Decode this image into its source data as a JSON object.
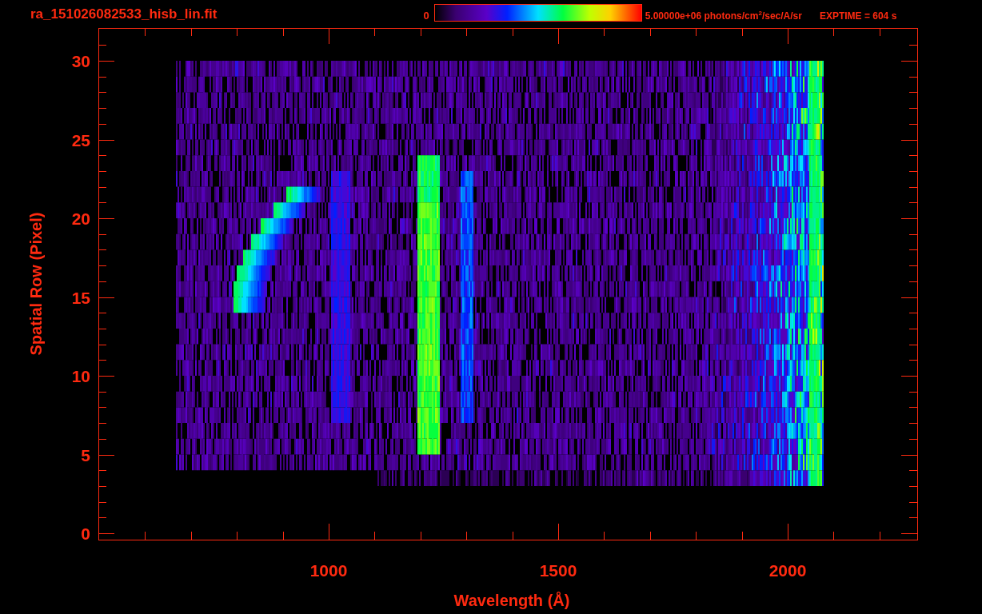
{
  "title": "ra_151026082533_hisb_lin.fit",
  "colorbar": {
    "min_label": "0",
    "max_label": "5.00000e+06 photons/cm$^{2}$/sec/A/sr"
  },
  "exposure": "EXPTIME = 604 s",
  "plot": {
    "xlabel": "Wavelength (Å)",
    "ylabel": "Spatial Row (Pixel)",
    "xticks": [
      "1000",
      "1500",
      "2000"
    ],
    "yticks": [
      "30",
      "25",
      "20",
      "15",
      "10",
      "5",
      "0"
    ]
  }
}
